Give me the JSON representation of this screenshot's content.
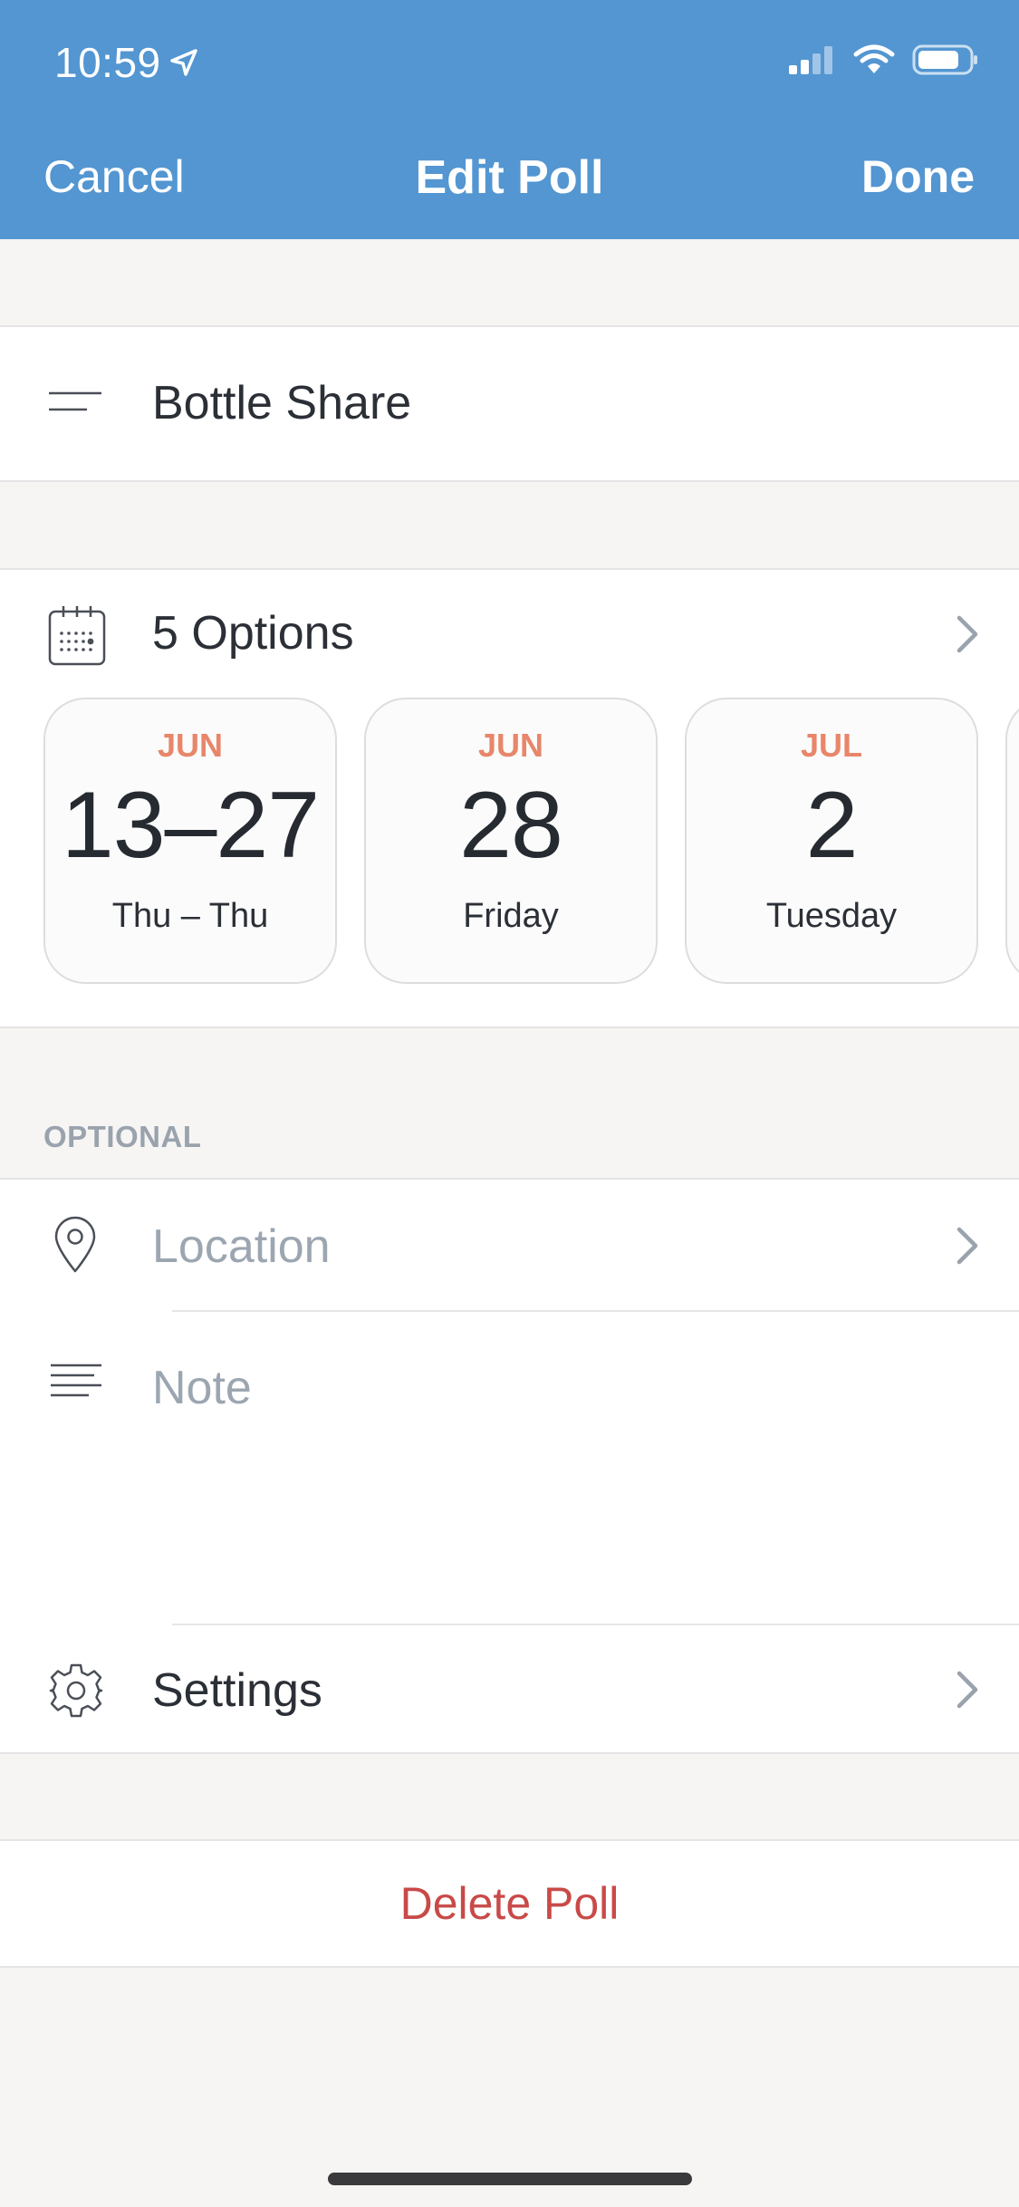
{
  "status_bar": {
    "time": "10:59"
  },
  "nav": {
    "cancel_label": "Cancel",
    "title": "Edit Poll",
    "done_label": "Done"
  },
  "poll_title": "Bottle Share",
  "options": {
    "label": "5 Options",
    "cards": [
      {
        "month": "JUN",
        "day": "13–27",
        "weekday": "Thu – Thu"
      },
      {
        "month": "JUN",
        "day": "28",
        "weekday": "Friday"
      },
      {
        "month": "JUL",
        "day": "2",
        "weekday": "Tuesday"
      }
    ]
  },
  "optional": {
    "header": "OPTIONAL",
    "location_placeholder": "Location",
    "note_placeholder": "Note",
    "settings_label": "Settings"
  },
  "delete_label": "Delete Poll",
  "colors": {
    "header_bg": "#5396d1",
    "month_accent": "#e8866a",
    "delete_red": "#c84a48",
    "placeholder": "#9ca6b1"
  },
  "icons": [
    "location-arrow-icon",
    "signal-icon",
    "wifi-icon",
    "battery-icon",
    "title-lines-icon",
    "calendar-icon",
    "chevron-right-icon",
    "map-pin-icon",
    "note-lines-icon",
    "gear-icon"
  ]
}
